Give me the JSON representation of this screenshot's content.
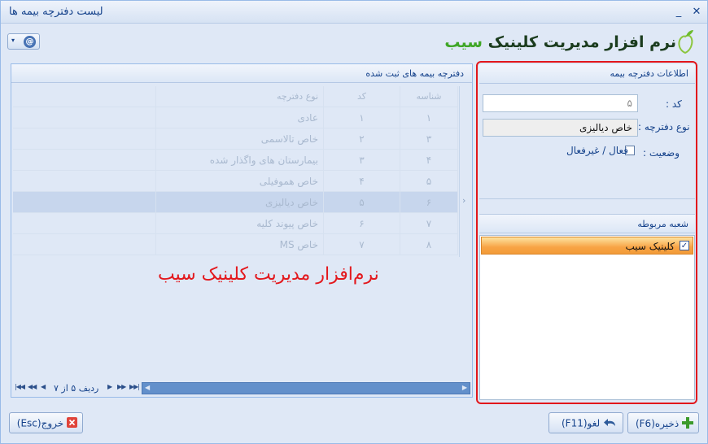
{
  "window": {
    "title": "لیست دفترچه بیمه ها",
    "min_glyph": "_",
    "close_glyph": "✕"
  },
  "toolbar": {
    "menu_arrow": "▾",
    "help_glyph": "@"
  },
  "logo": {
    "text_main": "نرم افزار مدیریت کلینیک",
    "text_brand": "سیب"
  },
  "details": {
    "header": "اطلاعات دفترچه بیمه",
    "code_label": "کد :",
    "code_value": "۵",
    "type_label": "نوع دفترچه :",
    "type_value": "خاص دیالیزی",
    "status_label": "وضعیت :",
    "status_option": "فعال / غیرفعال",
    "status_checked": false
  },
  "branches": {
    "header": "شعبه مربوطه",
    "items": [
      {
        "label": "کلینیک سیب",
        "checked": true
      }
    ]
  },
  "grid": {
    "header": "دفترچه بیمه های ثبت شده",
    "columns": [
      "شناسه",
      "کد",
      "نوع دفترچه"
    ],
    "rows": [
      [
        "۱",
        "۱",
        "عادی"
      ],
      [
        "۳",
        "۲",
        "خاص تالاسمی"
      ],
      [
        "۴",
        "۳",
        "بیمارستان های واگذار شده"
      ],
      [
        "۵",
        "۴",
        "خاص هموفیلی"
      ],
      [
        "۶",
        "۵",
        "خاص دیالیزی"
      ],
      [
        "۷",
        "۶",
        "خاص پیوند کلیه"
      ],
      [
        "۸",
        "۷",
        "خاص MS"
      ]
    ],
    "selected_row": 4,
    "record_text": "ردیف ۵ از ۷",
    "watermark": "نرم‌افزار مدیریت کلینیک سیب"
  },
  "buttons": {
    "exit": "خروج(Esc)",
    "cancel": "لغو(F11)",
    "save": "ذخیره(F6)"
  },
  "colors": {
    "highlight_frame": "#e2161b",
    "selected_branch": "#f8a445",
    "brand_green": "#3fa626"
  }
}
